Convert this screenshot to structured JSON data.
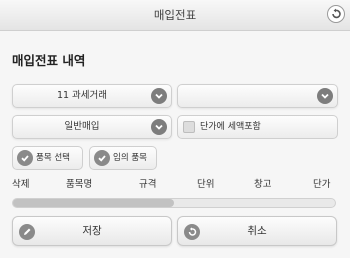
{
  "header": {
    "title": "매입전표"
  },
  "section": {
    "title": "매입전표 내역"
  },
  "form": {
    "tax_type_select": {
      "value": "11 과세거래"
    },
    "second_select": {
      "value": ""
    },
    "purchase_type_select": {
      "value": "일반매입"
    },
    "vat_included_checkbox": {
      "label": "단가에 세액포함",
      "checked": false
    }
  },
  "item_buttons": {
    "select_item_label": "품목 선택",
    "custom_item_label": "임의 품목"
  },
  "table": {
    "columns": [
      "삭제",
      "품목명",
      "규격",
      "단위",
      "창고",
      "단가"
    ]
  },
  "scrollbar": {
    "position_fraction": 0.0,
    "visible_fraction": 0.5
  },
  "footer": {
    "save_label": "저장",
    "cancel_label": "취소"
  },
  "icons": {
    "back": "back-arrow-icon",
    "dropdown": "chevron-down-icon",
    "check": "check-icon",
    "pencil": "pencil-icon",
    "undo": "undo-icon"
  },
  "colors": {
    "background": "#f6f6f6",
    "header_bg": "#e8e8e8",
    "icon_bg": "#7d7d7d"
  }
}
